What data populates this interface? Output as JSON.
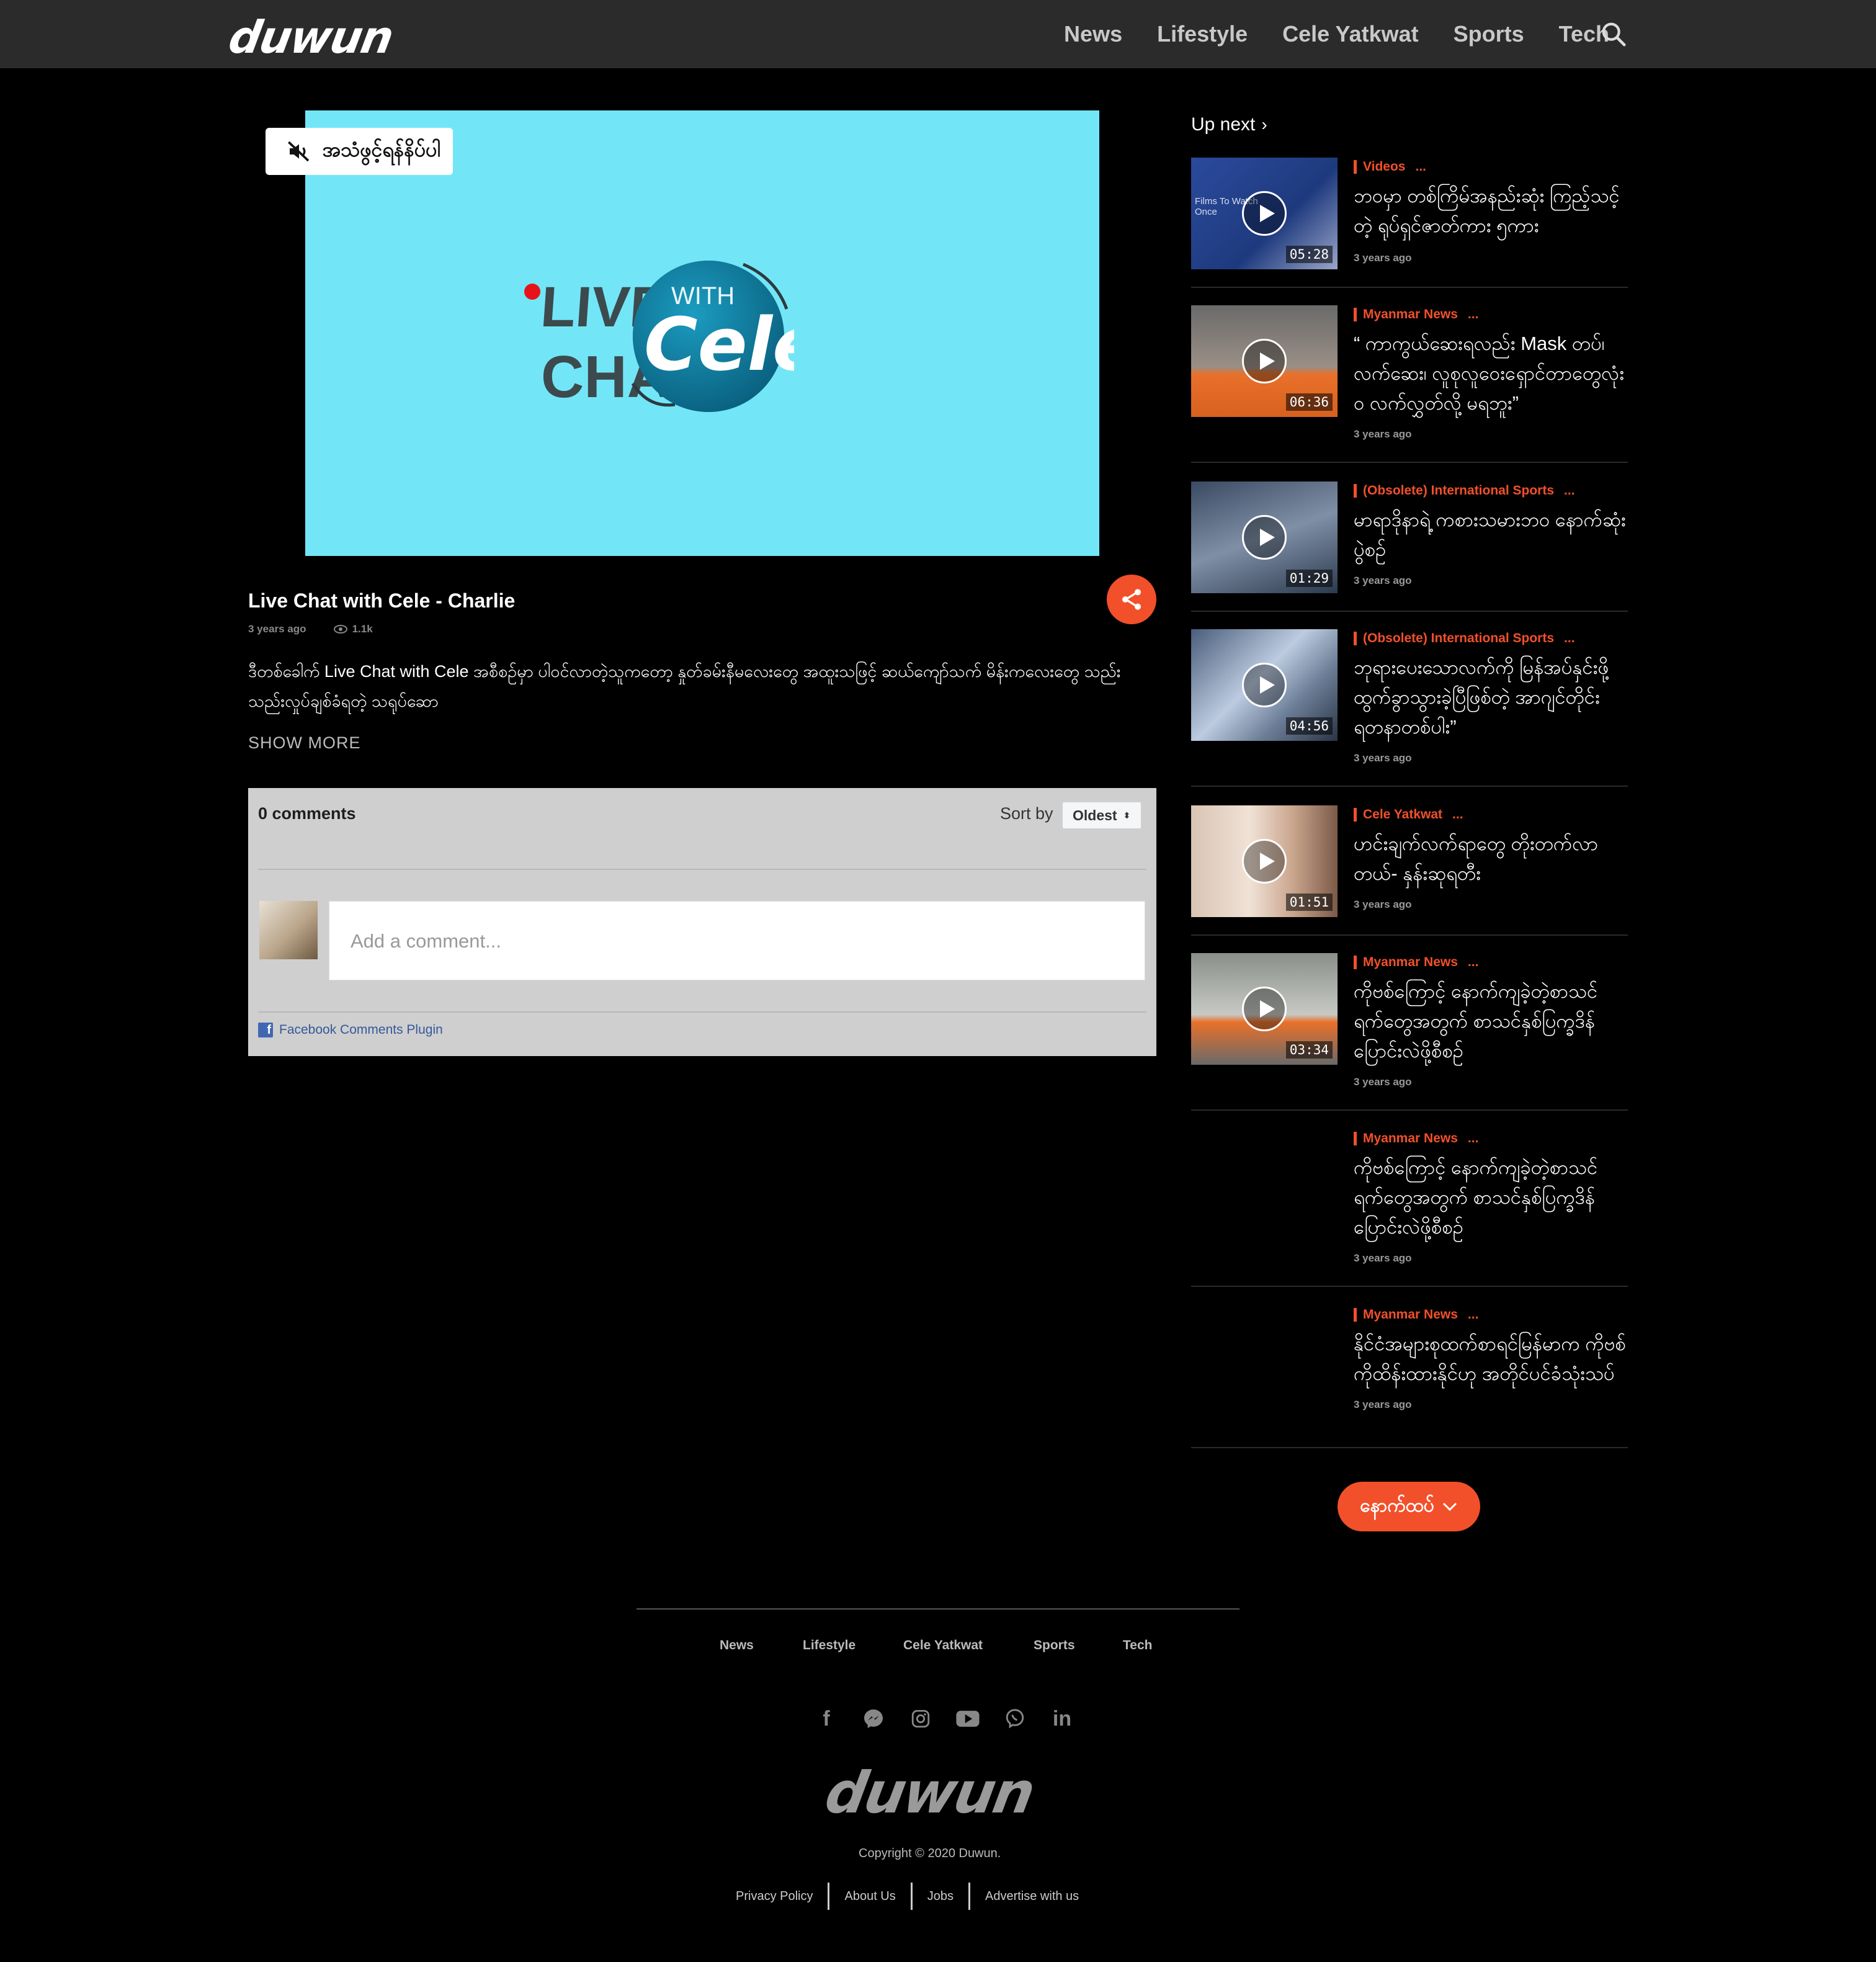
{
  "brand": {
    "logo_text": "duwun"
  },
  "nav": {
    "links": [
      "News",
      "Lifestyle",
      "Cele Yatkwat",
      "Sports",
      "Tech"
    ],
    "search_icon": "search-icon"
  },
  "player": {
    "mute_label": "အသံဖွင့်ရန်နိပ်ပါ",
    "logo": {
      "live": "LIVE",
      "chat": "CHAT",
      "with": "WITH",
      "cele": "Cele"
    },
    "frame_color": "#72e6f7"
  },
  "video": {
    "title": "Live Chat with Cele - Charlie",
    "ago": "3 years ago",
    "views": "1.1k",
    "description": "ဒီတစ်ခေါက် Live Chat with Cele အစီစဉ်မှာ ပါဝင်လာတဲ့သူကတော့ နှုတ်ခမ်းနီမလေးတွေ အထူးသဖြင့် ဆယ်ကျော်သက် မိန်းကလေးတွေ သည်းသည်းလှုပ်ချစ်ခံရတဲ့ သရုပ်ဆော",
    "show_more": "SHOW MORE"
  },
  "comments": {
    "count": "0 comments",
    "sort_label": "Sort by",
    "sort_value": "Oldest",
    "placeholder": "Add a comment...",
    "plugin": "Facebook Comments Plugin"
  },
  "sidebar": {
    "heading": "Up next",
    "items": [
      {
        "category": "Videos",
        "title": "ဘဝမှာ တစ်ကြိမ်အနည်းဆုံး ကြည့်သင့်တဲ့ ရုပ်ရှင်ဇာတ်ကား ၅ကား",
        "ago": "3 years ago",
        "duration": "05:28",
        "thumb_label": "Films To Watch Once"
      },
      {
        "category": "Myanmar News",
        "title": "“ ကာကွယ်ဆေးရလည်း Mask တပ်၊ လက်ဆေး၊ လူစုလူဝေးရှောင်တာတွေလုံးဝ လက်လွှတ်လို့ မရဘူး”",
        "ago": "3 years ago",
        "duration": "06:36"
      },
      {
        "category": "(Obsolete) International Sports",
        "title": "မာရာဒိုနာရဲ့ ကစားသမားဘဝ နောက်ဆုံးပွဲစဉ်",
        "ago": "3 years ago",
        "duration": "01:29"
      },
      {
        "category": "(Obsolete) International Sports",
        "title": "ဘုရားပေးသောလက်ကို မြန်အပ်နှင်းဖို့ ထွက်ခွာသွားခဲ့ပြီဖြစ်တဲ့ အာဂျင်တိုင်း ရတနာတစ်ပါး”",
        "ago": "3 years ago",
        "duration": "04:56"
      },
      {
        "category": "Cele Yatkwat",
        "title": "ဟင်းချက်လက်ရာတွေ တိုးတက်လာတယ်- နှန်းဆုရတီး",
        "ago": "3 years ago",
        "duration": "01:51"
      },
      {
        "category": "Myanmar News",
        "title": "ကိုဗစ်ကြောင့် နောက်ကျခဲ့တဲ့စာသင်ရက်တွေအတွက် စာသင်နှစ်ပြက္ခဒိန်ပြောင်းလဲဖို့စီစဉ်",
        "ago": "3 years ago",
        "duration": "03:34"
      },
      {
        "category": "Myanmar News",
        "title": "ကိုဗစ်ကြောင့် နောက်ကျခဲ့တဲ့စာသင်ရက်တွေအတွက် စာသင်နှစ်ပြက္ခဒိန်ပြောင်းလဲဖို့စီစဉ်",
        "ago": "3 years ago"
      },
      {
        "category": "Myanmar News",
        "title": "နိုင်ငံအများစုထက်စာရင်မြန်မာက ကိုဗစ်ကိုထိန်းထားနိုင်ဟု အတိုင်ပင်ခံသုံးသပ်",
        "ago": "3 years ago"
      }
    ],
    "more_label": "နောက်ထပ်",
    "dots": "..."
  },
  "footer": {
    "nav": [
      "News",
      "Lifestyle",
      "Cele Yatkwat",
      "Sports",
      "Tech"
    ],
    "social": [
      "facebook-icon",
      "messenger-icon",
      "instagram-icon",
      "youtube-icon",
      "viber-icon",
      "linkedin-icon"
    ],
    "logo_text": "duwun",
    "copyright": "Copyright © 2020 Duwun.",
    "links": [
      "Privacy Policy",
      "About Us",
      "Jobs",
      "Advertise with us"
    ]
  },
  "colors": {
    "accent": "#f2502a",
    "nav_bg": "#2b2b2b",
    "page_bg": "#000000"
  }
}
